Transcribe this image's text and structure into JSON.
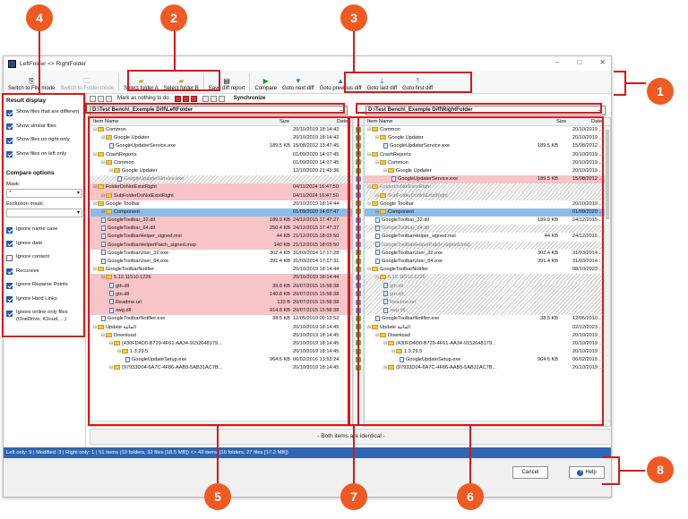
{
  "window": {
    "title": "LeftFolder <> RightFolder",
    "minimize_icon": "minimize-icon",
    "maximize_icon": "maximize-icon",
    "close_icon": "close-icon"
  },
  "ribbon": {
    "switch_file_mode": "Switch to File mode",
    "switch_folder_mode": "Switch to Folder mode",
    "select_a": "Select folder A",
    "select_b": "Select folder B",
    "save_report": "Save diff report",
    "compare": "Compare",
    "next_diff": "Goto next diff",
    "prev_diff": "Goto previous diff",
    "last_diff": "Goto last diff",
    "first_diff": "Goto first diff"
  },
  "toolbar2": {
    "mark_nothing": "Mark as nothing to do",
    "synchronize": "Synchronize"
  },
  "result_display": {
    "title": "Result display",
    "options": [
      {
        "label": "Show files that are different",
        "checked": true
      },
      {
        "label": "Show similar files",
        "checked": true
      },
      {
        "label": "Show files on right only",
        "checked": true
      },
      {
        "label": "Show files on left only",
        "checked": true
      }
    ]
  },
  "compare_options": {
    "title": "Compare options",
    "mask_label": "Mask:",
    "mask_value": "*",
    "exclusion_label": "Exclusion mask:",
    "exclusion_value": "",
    "options": [
      {
        "label": "Ignore name case",
        "checked": true
      },
      {
        "label": "Ignore date",
        "checked": true
      },
      {
        "label": "Ignore content",
        "checked": false
      },
      {
        "label": "Recursive",
        "checked": true
      },
      {
        "label": "Ignore Reparse Points",
        "checked": true
      },
      {
        "label": "Ignore Hard Links",
        "checked": true
      },
      {
        "label": "Ignore online only files (OneDrive, iCloud, ...)",
        "checked": true
      }
    ]
  },
  "left": {
    "path": "D:\\Test Bench\\_Exemple Diff\\LeftFolder",
    "columns": {
      "name": "Item Name",
      "size": "Size",
      "date": "Date"
    },
    "rows": [
      {
        "name": "Common",
        "size": "",
        "date": "20/10/2019 18:14:42",
        "type": "folder",
        "indent": 0,
        "state": "normal"
      },
      {
        "name": "Google Updater",
        "size": "",
        "date": "20/10/2019 18:14:42",
        "type": "folder",
        "indent": 1,
        "state": "normal"
      },
      {
        "name": "GoogleUpdaterService.exe",
        "size": "189.5 KB",
        "date": "15/08/2012 13:47:45",
        "type": "file",
        "indent": 2,
        "state": "normal"
      },
      {
        "name": "CrashReports",
        "size": "",
        "date": "01/09/2020 14:07:45",
        "type": "folder",
        "indent": 0,
        "state": "normal"
      },
      {
        "name": "Common",
        "size": "",
        "date": "01/09/2020 14:07:45",
        "type": "folder",
        "indent": 1,
        "state": "normal"
      },
      {
        "name": "Google Updater",
        "size": "",
        "date": "12/10/2020 21:43:36",
        "type": "folder",
        "indent": 2,
        "state": "normal"
      },
      {
        "name": "GoogleUpdaterService.exe",
        "size": "",
        "date": "",
        "type": "file",
        "indent": 3,
        "state": "hatch"
      },
      {
        "name": "FolderDoNotExistRight",
        "size": "",
        "date": "04/11/2024 16:47:50",
        "type": "folder",
        "indent": 0,
        "state": "diff"
      },
      {
        "name": "SubFolderDoNotExistRight",
        "size": "",
        "date": "04/11/2024 16:47:50",
        "type": "folder",
        "indent": 1,
        "state": "diff"
      },
      {
        "name": "Google Toolbar",
        "size": "",
        "date": "20/10/2019 18:14:44",
        "type": "folder",
        "indent": 0,
        "state": "normal"
      },
      {
        "name": "Component",
        "size": "",
        "date": "01/09/2020 14:07:47",
        "type": "folder",
        "indent": 1,
        "state": "sel"
      },
      {
        "name": "GoogleToolbar_32.dll",
        "size": "189.9 KB",
        "date": "24/12/2015 17:47:27",
        "type": "file",
        "indent": 1,
        "state": "diff"
      },
      {
        "name": "GoogleToolbar_64.dll",
        "size": "250.4 KB",
        "date": "24/12/2015 17:47:37",
        "type": "file",
        "indent": 1,
        "state": "diff"
      },
      {
        "name": "GoogleToolbarHelper_signed.msi",
        "size": "44 KB",
        "date": "21/12/2015 18:03:50",
        "type": "file",
        "indent": 1,
        "state": "diff"
      },
      {
        "name": "GoogleToolbarHelperPatch_signed.msp",
        "size": "140 KB",
        "date": "21/12/2015 18:03:50",
        "type": "file",
        "indent": 1,
        "state": "diff"
      },
      {
        "name": "GoogleToolbarUser_32.exe",
        "size": "302.4 KB",
        "date": "31/03/2014 17:17:28",
        "type": "file",
        "indent": 1,
        "state": "normal"
      },
      {
        "name": "GoogleToolbarUser_64.exe",
        "size": "391.4 KB",
        "date": "31/03/2014 17:17:31",
        "type": "file",
        "indent": 1,
        "state": "normal"
      },
      {
        "name": "GoogleToolbarNotifier",
        "size": "",
        "date": "20/10/2019 18:14:44",
        "type": "folder",
        "indent": 0,
        "state": "normal"
      },
      {
        "name": "5.12.11510.1226",
        "size": "",
        "date": "20/10/2019 18:14:44",
        "type": "folder",
        "indent": 1,
        "state": "diff"
      },
      {
        "name": "gth.dll",
        "size": "39.8 KB",
        "date": "20/07/2015 15:58:38",
        "type": "file",
        "indent": 2,
        "state": "diff"
      },
      {
        "name": "gtn.dll",
        "size": "140.8 KB",
        "date": "20/07/2015 15:58:38",
        "type": "file",
        "indent": 2,
        "state": "diff"
      },
      {
        "name": "Readme.url",
        "size": "133 B",
        "date": "20/07/2015 15:58:38",
        "type": "file",
        "indent": 2,
        "state": "diff"
      },
      {
        "name": "swg.dll",
        "size": "914.8 KB",
        "date": "20/07/2015 15:58:38",
        "type": "file",
        "indent": 2,
        "state": "diff"
      },
      {
        "name": "GoogleToolbarNotifier.exe",
        "size": "38.5 KB",
        "date": "12/05/2010 09:13:52",
        "type": "file",
        "indent": 1,
        "state": "normal"
      },
      {
        "name": "Update المائية",
        "size": "",
        "date": "20/10/2019 18:14:45",
        "type": "folder",
        "indent": 0,
        "state": "normal"
      },
      {
        "name": "Download",
        "size": "",
        "date": "20/10/2019 18:14:45",
        "type": "folder",
        "indent": 1,
        "state": "normal"
      },
      {
        "name": "{430FD4D0-B729-4F61-AA34-9152648179...",
        "size": "",
        "date": "20/10/2019 18:14:45",
        "type": "folder",
        "indent": 2,
        "state": "normal"
      },
      {
        "name": "1.3.29.5",
        "size": "",
        "date": "20/10/2019 18:14:45",
        "type": "folder",
        "indent": 3,
        "state": "normal"
      },
      {
        "name": "GoogleUpdateSetup.exe",
        "size": "964.6 KB",
        "date": "06/02/2016 13:53:24",
        "type": "file",
        "indent": 4,
        "state": "normal"
      },
      {
        "name": "{97933D04-6A7C-4F86-AAB5-5AB31AC7B...",
        "size": "",
        "date": "20/10/2019 18:14:45",
        "type": "folder",
        "indent": 2,
        "state": "normal"
      }
    ]
  },
  "right": {
    "path": "D:\\Test Bench\\_Exemple Diff\\RightFolder",
    "columns": {
      "name": "Item Name",
      "size": "Size",
      "date": "Date"
    },
    "rows": [
      {
        "name": "Common",
        "size": "",
        "date": "20/10/2019 ...",
        "type": "folder",
        "indent": 0,
        "state": "normal"
      },
      {
        "name": "Google Updater",
        "size": "",
        "date": "20/10/2019 ...",
        "type": "folder",
        "indent": 1,
        "state": "normal"
      },
      {
        "name": "GoogleUpdaterService.exe",
        "size": "189.5 KB",
        "date": "15/08/2012 ...",
        "type": "file",
        "indent": 2,
        "state": "normal"
      },
      {
        "name": "CrashReports",
        "size": "",
        "date": "20/10/2019 ...",
        "type": "folder",
        "indent": 0,
        "state": "normal"
      },
      {
        "name": "Common",
        "size": "",
        "date": "20/10/2019 ...",
        "type": "folder",
        "indent": 1,
        "state": "normal"
      },
      {
        "name": "Google Updater",
        "size": "",
        "date": "20/10/2019 ...",
        "type": "folder",
        "indent": 2,
        "state": "normal"
      },
      {
        "name": "GoogleUpdaterService.exe",
        "size": "189.5 KB",
        "date": "15/08/2012 ...",
        "type": "file",
        "indent": 3,
        "state": "diff"
      },
      {
        "name": "FolderDoNotExistRight",
        "size": "",
        "date": "",
        "type": "folder",
        "indent": 0,
        "state": "hatch"
      },
      {
        "name": "SubFolderDoNotExistRight",
        "size": "",
        "date": "",
        "type": "folder",
        "indent": 1,
        "state": "hatch"
      },
      {
        "name": "Google Toolbar",
        "size": "",
        "date": "20/10/2019 ...",
        "type": "folder",
        "indent": 0,
        "state": "normal"
      },
      {
        "name": "Component",
        "size": "",
        "date": "01/09/2020 ...",
        "type": "folder",
        "indent": 1,
        "state": "sel"
      },
      {
        "name": "GoogleToolbar_32.dll",
        "size": "189.9 KB",
        "date": "24/12/2015 ...",
        "type": "file",
        "indent": 1,
        "state": "normal"
      },
      {
        "name": "GoogleToolbar_64.dll",
        "size": "",
        "date": "",
        "type": "file",
        "indent": 1,
        "state": "hatch"
      },
      {
        "name": "GoogleToolbarHelper_signed.msi",
        "size": "44 KB",
        "date": "24/12/2015 ...",
        "type": "file",
        "indent": 1,
        "state": "normal"
      },
      {
        "name": "GoogleToolbarHelperPatch_signed.msp",
        "size": "",
        "date": "",
        "type": "file",
        "indent": 1,
        "state": "hatch"
      },
      {
        "name": "GoogleToolbarUser_32.exe",
        "size": "302.4 KB",
        "date": "31/03/2014 ...",
        "type": "file",
        "indent": 1,
        "state": "normal"
      },
      {
        "name": "GoogleToolbarUser_64.exe",
        "size": "391.4 KB",
        "date": "31/03/2014 ...",
        "type": "file",
        "indent": 1,
        "state": "normal"
      },
      {
        "name": "GoogleToolbarNotifier",
        "size": "",
        "date": "08/10/2023 ...",
        "type": "folder",
        "indent": 0,
        "state": "normal"
      },
      {
        "name": "5.12.11510.1226",
        "size": "",
        "date": "",
        "type": "folder",
        "indent": 1,
        "state": "hatch"
      },
      {
        "name": "gth.dll",
        "size": "",
        "date": "",
        "type": "file",
        "indent": 2,
        "state": "hatch"
      },
      {
        "name": "gtn.dll",
        "size": "",
        "date": "",
        "type": "file",
        "indent": 2,
        "state": "hatch"
      },
      {
        "name": "Readme.url",
        "size": "",
        "date": "",
        "type": "file",
        "indent": 2,
        "state": "hatch"
      },
      {
        "name": "swg.dll",
        "size": "",
        "date": "",
        "type": "file",
        "indent": 2,
        "state": "hatch"
      },
      {
        "name": "GoogleToolbarNotifier.exe",
        "size": "38.5 KB",
        "date": "12/05/2010 ...",
        "type": "file",
        "indent": 1,
        "state": "normal"
      },
      {
        "name": "Update المائية",
        "size": "",
        "date": "02/12/2023 ...",
        "type": "folder",
        "indent": 0,
        "state": "normal"
      },
      {
        "name": "Download",
        "size": "",
        "date": "20/10/2019 ...",
        "type": "folder",
        "indent": 1,
        "state": "normal"
      },
      {
        "name": "{430FD4D0-B729-4F61-AA34-9152648179...",
        "size": "",
        "date": "20/10/2019 ...",
        "type": "folder",
        "indent": 2,
        "state": "normal"
      },
      {
        "name": "1.3.29.5",
        "size": "",
        "date": "20/10/2019 ...",
        "type": "folder",
        "indent": 3,
        "state": "normal"
      },
      {
        "name": "GoogleUpdateSetup.exe",
        "size": "964.6 KB",
        "date": "06/02/2016 ...",
        "type": "file",
        "indent": 4,
        "state": "normal"
      },
      {
        "name": "{97933D04-6A7C-4F86-AAB5-5AB31AC7B...",
        "size": "",
        "date": "20/10/2019 ...",
        "type": "folder",
        "indent": 2,
        "state": "normal"
      }
    ]
  },
  "middle_markers": [
    "g",
    "g",
    "g",
    "g",
    "g",
    "g",
    "b",
    "b",
    "b",
    "g",
    "g",
    "b",
    "b",
    "b",
    "b",
    "g",
    "g",
    "g",
    "b",
    "b",
    "b",
    "b",
    "b",
    "g",
    "g",
    "g",
    "g",
    "g",
    "g",
    "g"
  ],
  "identical_message": "- Both items are identical -",
  "status": {
    "text": "Left only: 9  |  Modified: 3  |  Right only: 1  |  51 items (19 folders, 32 files [18.5 MB]) <> 43 items (16 folders, 27 files [17.2 MB])"
  },
  "buttons": {
    "cancel": "Cancel",
    "help": "Help"
  },
  "callouts": [
    "1",
    "2",
    "3",
    "4",
    "5",
    "6",
    "7",
    "8"
  ],
  "colors": {
    "accent": "#2f66b3",
    "diff": "#f7c4c7",
    "selected": "#8fbce6",
    "callout": "#ef5a23",
    "outline": "#d81818"
  }
}
